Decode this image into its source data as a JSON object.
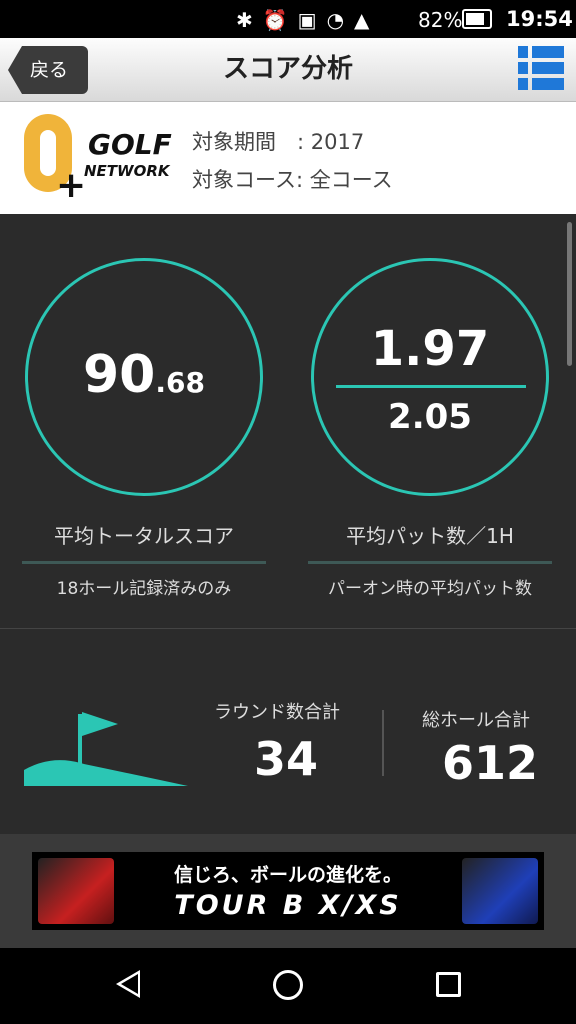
{
  "status_bar": {
    "battery": "82%",
    "time": "19:54",
    "icons": [
      "bluetooth-icon",
      "alarm-icon",
      "voicemail-icon",
      "wifi-icon",
      "signal-icon",
      "battery-charging-icon"
    ]
  },
  "header": {
    "back_label": "戻る",
    "title": "スコア分析",
    "menu_icon": "list-menu-icon"
  },
  "info": {
    "logo_golf": "GOLF",
    "logo_network": "NETWORK",
    "logo_plus": "+",
    "period_label": "対象期間　: 2017",
    "course_label": "対象コース: 全コース"
  },
  "avg_score": {
    "integer": "90",
    "decimal": ".68",
    "label": "平均トータルスコア",
    "sub": "18ホール記録済みのみ"
  },
  "avg_putt": {
    "top": "1.97",
    "bottom": "2.05",
    "label": "平均パット数／1H",
    "sub": "パーオン時の平均パット数"
  },
  "totals": {
    "round_label": "ラウンド数合計",
    "round_value": "34",
    "hole_label": "総ホール合計",
    "hole_value": "612"
  },
  "ad": {
    "top_text": "信じろ、ボールの進化を。",
    "bottom_text": "TOUR B X/XS"
  },
  "colors": {
    "accent": "#2bc6b4",
    "menu_blue": "#1f78d8",
    "logo_yellow": "#f0b43a",
    "content_bg": "#2b2b2b"
  }
}
